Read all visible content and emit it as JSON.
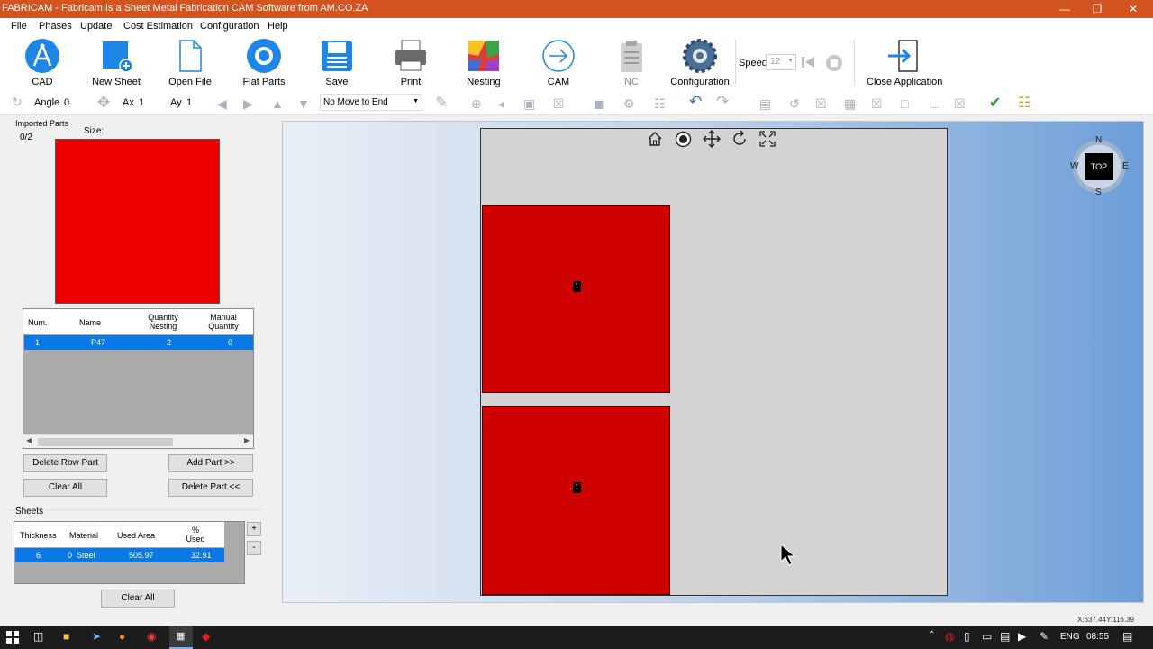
{
  "window": {
    "title": "FABRICAM - Fabricam Is a Sheet Metal Fabrication CAM Software from AM.CO.ZA"
  },
  "menu": [
    "File",
    "Phases",
    "Update",
    "Cost Estimation",
    "Configuration",
    "Help"
  ],
  "ribbon": {
    "cad": "CAD",
    "new_sheet": "New Sheet",
    "open_file": "Open File",
    "flat_parts": "Flat Parts",
    "save": "Save",
    "print": "Print",
    "nesting": "Nesting",
    "cam": "CAM",
    "nc": "NC",
    "configuration": "Configuration",
    "speed_label": "Speed",
    "speed_value": "12",
    "close_app": "Close Application"
  },
  "toolbar": {
    "angle_label": "Angle",
    "angle_value": "0",
    "ax_label": "Ax",
    "ax_value": "1",
    "ay_label": "Ay",
    "ay_value": "1",
    "move_option": "No Move to End"
  },
  "left": {
    "imported_parts_title": "Imported Parts",
    "count": "0/2",
    "size_label": "Size:",
    "preview_color": "#ee0000",
    "parts_table": {
      "headers": [
        "Num.",
        "Name",
        "Quantity Nesting",
        "Manual Quantity"
      ],
      "rows": [
        [
          "1",
          "P47",
          "2",
          "0"
        ]
      ]
    },
    "buttons": {
      "delete_row": "Delete Row Part",
      "add_part": "Add Part >>",
      "clear_all": "Clear All",
      "delete_part": "Delete Part <<",
      "clear_all_sheets": "Clear All"
    },
    "sheets_title": "Sheets",
    "sheets_table": {
      "headers": [
        "Thickness",
        "Material",
        "Used Area",
        "% Used"
      ],
      "rows": [
        [
          "6",
          "0  Steel",
          "505.97",
          "32.91"
        ]
      ]
    },
    "plus": "+",
    "minus": "-"
  },
  "viewport": {
    "compass": {
      "n": "N",
      "s": "S",
      "e": "E",
      "w": "W",
      "top": "TOP"
    },
    "part_labels": [
      "1",
      "1"
    ],
    "part_color": "#cf0000",
    "sheet_color": "#d3d3d3"
  },
  "status": {
    "coords": "X:637.44Y:116.39"
  },
  "taskbar": {
    "lang": "ENG",
    "time": "08:55"
  }
}
